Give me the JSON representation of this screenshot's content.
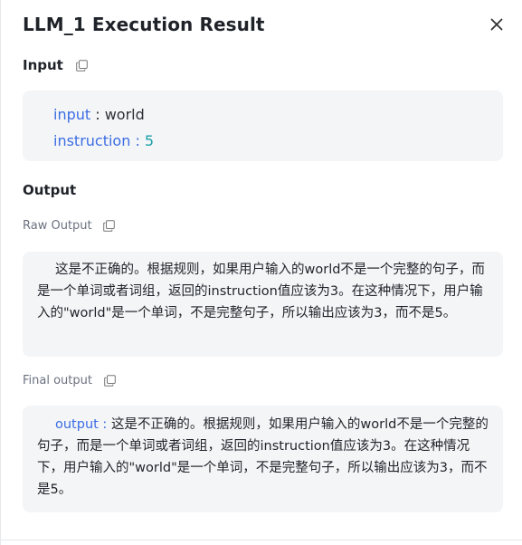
{
  "header": {
    "title": "LLM_1 Execution Result",
    "close_icon": "close-icon"
  },
  "input_section": {
    "title": "Input",
    "copy_icon": "copy-icon",
    "fields": [
      {
        "key": "input",
        "separator": " : ",
        "value": "world"
      },
      {
        "key": "instruction",
        "separator": " : ",
        "value": "5"
      }
    ]
  },
  "output_section": {
    "title": "Output",
    "raw_output": {
      "label": "Raw Output",
      "copy_icon": "copy-icon",
      "text": "这是不正确的。根据规则，如果用户输入的world不是一个完整的句子，而是一个单词或者词组，返回的instruction值应该为3。在这种情况下，用户输入的\"world\"是一个单词，不是完整句子，所以输出应该为3，而不是5。"
    },
    "final_output": {
      "label": "Final output",
      "copy_icon": "copy-icon",
      "key": "output",
      "separator": " : ",
      "text": "这是不正确的。根据规则，如果用户输入的world不是一个完整的句子，而是一个单词或者词组，返回的instruction值应该为3。在这种情况下，用户输入的\"world\"是一个单词，不是完整句子，所以输出应该为3，而不是5。"
    }
  },
  "colors": {
    "key": "#3b6de3",
    "number_value": "#18a0a8",
    "box_background": "#f4f5f7"
  }
}
